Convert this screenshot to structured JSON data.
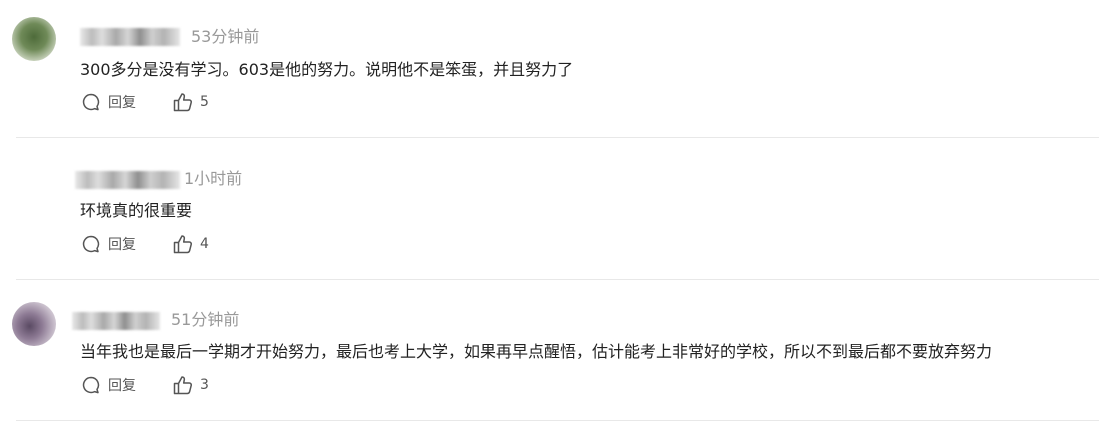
{
  "comments": [
    {
      "time": "53分钟前",
      "text": "300多分是没有学习。603是他的努力。说明他不是笨蛋，并且努力了",
      "reply_label": "回复",
      "likes": "5",
      "avatar": "green-avatar"
    },
    {
      "time": "1小时前",
      "text": "环境真的很重要",
      "reply_label": "回复",
      "likes": "4",
      "avatar": "none"
    },
    {
      "time": "51分钟前",
      "text": "当年我也是最后一学期才开始努力，最后也考上大学，如果再早点醒悟，估计能考上非常好的学校，所以不到最后都不要放弃努力",
      "reply_label": "回复",
      "likes": "3",
      "avatar": "purple-avatar"
    }
  ],
  "icons": {
    "reply": "comment-bubble-icon",
    "like": "thumbs-up-icon"
  },
  "colors": {
    "text": "#222222",
    "meta": "#999999",
    "action": "#555555",
    "divider": "#e8e8e8"
  }
}
